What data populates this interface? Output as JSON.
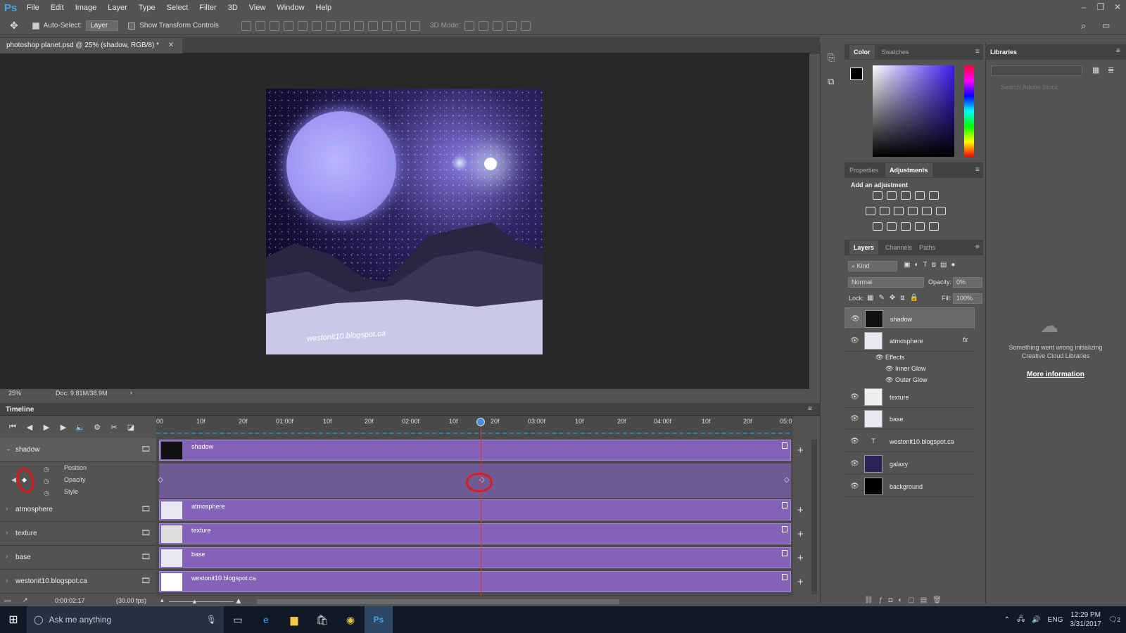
{
  "menubar": {
    "logo": "Ps",
    "items": [
      "File",
      "Edit",
      "Image",
      "Layer",
      "Type",
      "Select",
      "Filter",
      "3D",
      "View",
      "Window",
      "Help"
    ]
  },
  "options": {
    "auto_select": "Auto-Select:",
    "layer_select": "Layer",
    "transform": "Show Transform Controls",
    "mode3d": "3D Mode:"
  },
  "document": {
    "tab": "photoshop planet.psd @ 25% (shadow, RGB/8) *",
    "watermark": "westonit10.blogspot.ca",
    "zoom": "25%",
    "doc_size": "Doc: 9.81M/38.9M"
  },
  "timeline": {
    "title": "Timeline",
    "ruler": [
      "00",
      "10f",
      "20f",
      "01:00f",
      "10f",
      "20f",
      "02:00f",
      "10f",
      "20f",
      "03:00f",
      "10f",
      "20f",
      "04:00f",
      "10f",
      "20f",
      "05:0"
    ],
    "tracks": [
      {
        "name": "shadow",
        "clip": "shadow"
      },
      {
        "name": "atmosphere",
        "clip": "atmosphere"
      },
      {
        "name": "texture",
        "clip": "texture"
      },
      {
        "name": "base",
        "clip": "base"
      },
      {
        "name": "westonit10.blogspot.ca",
        "clip": "westonit10.blogspot.ca"
      }
    ],
    "props": [
      "Position",
      "Opacity",
      "Style"
    ],
    "timecode": "0:00:02:17",
    "fps": "(30.00 fps)"
  },
  "color_panel": {
    "tabs": [
      "Color",
      "Swatches"
    ]
  },
  "adjust_panel": {
    "tabs": [
      "Properties",
      "Adjustments"
    ],
    "heading": "Add an adjustment"
  },
  "layers_panel": {
    "tabs": [
      "Layers",
      "Channels",
      "Paths"
    ],
    "kind": "Kind",
    "blend": "Normal",
    "opacity_label": "Opacity:",
    "opacity": "0%",
    "lock_label": "Lock:",
    "fill_label": "Fill:",
    "fill": "100%",
    "layers": [
      "shadow",
      "atmosphere",
      "texture",
      "base",
      "westonit10.blogspot.ca",
      "galaxy",
      "background"
    ],
    "effects": [
      "Effects",
      "Inner Glow",
      "Outer Glow"
    ],
    "fx": "fx"
  },
  "libraries": {
    "tab": "Libraries",
    "search_placeholder": "Search Adobe Stock",
    "message": "Something went wrong initializing Creative Cloud Libraries",
    "link": "More information"
  },
  "taskbar": {
    "search": "Ask me anything",
    "lang": "ENG",
    "time": "12:29 PM",
    "date": "3/31/2017",
    "notif": "2"
  }
}
